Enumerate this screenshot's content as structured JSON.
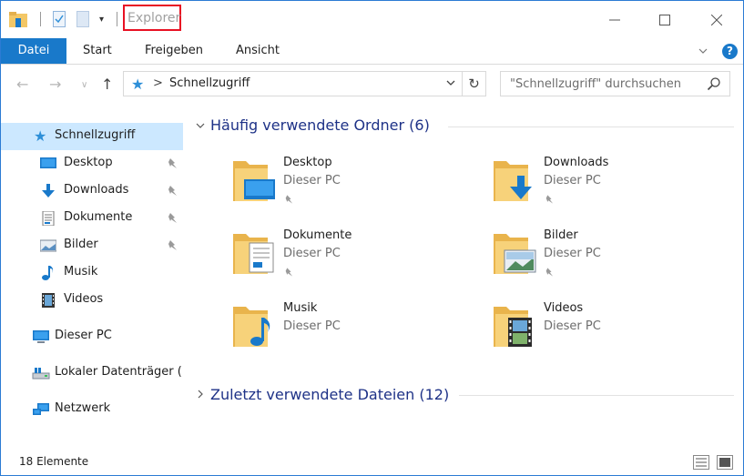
{
  "window": {
    "title": "Explorer"
  },
  "ribbon": {
    "tabs": [
      "Datei",
      "Start",
      "Freigeben",
      "Ansicht"
    ],
    "help_label": "?"
  },
  "address": {
    "path_root": "Schnellzugriff",
    "separator": ">"
  },
  "search": {
    "placeholder": "\"Schnellzugriff\" durchsuchen"
  },
  "sidebar": {
    "items": [
      {
        "label": "Schnellzugriff",
        "icon": "star-icon",
        "selected": true
      },
      {
        "label": "Desktop",
        "icon": "desktop-icon",
        "pinned": true
      },
      {
        "label": "Downloads",
        "icon": "download-arrow-icon",
        "pinned": true
      },
      {
        "label": "Dokumente",
        "icon": "document-icon",
        "pinned": true
      },
      {
        "label": "Bilder",
        "icon": "pictures-icon",
        "pinned": true
      },
      {
        "label": "Musik",
        "icon": "music-note-icon"
      },
      {
        "label": "Videos",
        "icon": "film-icon"
      },
      {
        "label": "Dieser PC",
        "icon": "computer-icon"
      },
      {
        "label": "Lokaler Datenträger (",
        "icon": "drive-icon"
      },
      {
        "label": "Netzwerk",
        "icon": "network-icon"
      }
    ]
  },
  "content": {
    "frequent": {
      "header": "Häufig verwendete Ordner (6)",
      "expanded": true,
      "folders": [
        {
          "name": "Desktop",
          "location": "Dieser PC",
          "pinned": true,
          "icon": "desktop-folder-icon"
        },
        {
          "name": "Downloads",
          "location": "Dieser PC",
          "pinned": true,
          "icon": "downloads-folder-icon"
        },
        {
          "name": "Dokumente",
          "location": "Dieser PC",
          "pinned": true,
          "icon": "documents-folder-icon"
        },
        {
          "name": "Bilder",
          "location": "Dieser PC",
          "pinned": true,
          "icon": "pictures-folder-icon"
        },
        {
          "name": "Musik",
          "location": "Dieser PC",
          "pinned": false,
          "icon": "music-folder-icon"
        },
        {
          "name": "Videos",
          "location": "Dieser PC",
          "pinned": false,
          "icon": "videos-folder-icon"
        }
      ]
    },
    "recent": {
      "header": "Zuletzt verwendete Dateien (12)",
      "expanded": false
    }
  },
  "status": {
    "item_count": "18 Elemente"
  },
  "colors": {
    "accent": "#1979ca",
    "selected_bg": "#cce8ff",
    "group_header": "#1e3287",
    "folder": "#f3c766"
  }
}
